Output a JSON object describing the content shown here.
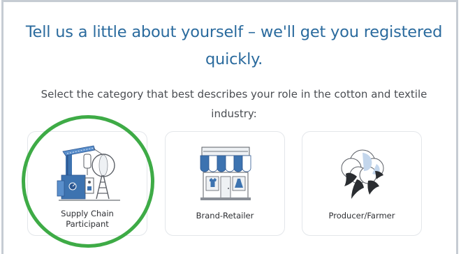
{
  "registration": {
    "heading": "Tell us a little about yourself – we'll get you registered quickly.",
    "prompt": "Select the category that best describes your role in the cotton and textile industry:"
  },
  "categories": [
    {
      "label": "Supply Chain\nParticipant",
      "icon": "spinning-machine-icon",
      "selected": true
    },
    {
      "label": "Brand-Retailer",
      "icon": "storefront-icon",
      "selected": false
    },
    {
      "label": "Producer/Farmer",
      "icon": "cotton-boll-icon",
      "selected": false
    }
  ],
  "colors": {
    "heading": "#2b6b9e",
    "text": "#4a4d52",
    "icon_blue": "#3d73b0",
    "highlight": "#3eab46",
    "card_border": "#e3e6ea"
  }
}
